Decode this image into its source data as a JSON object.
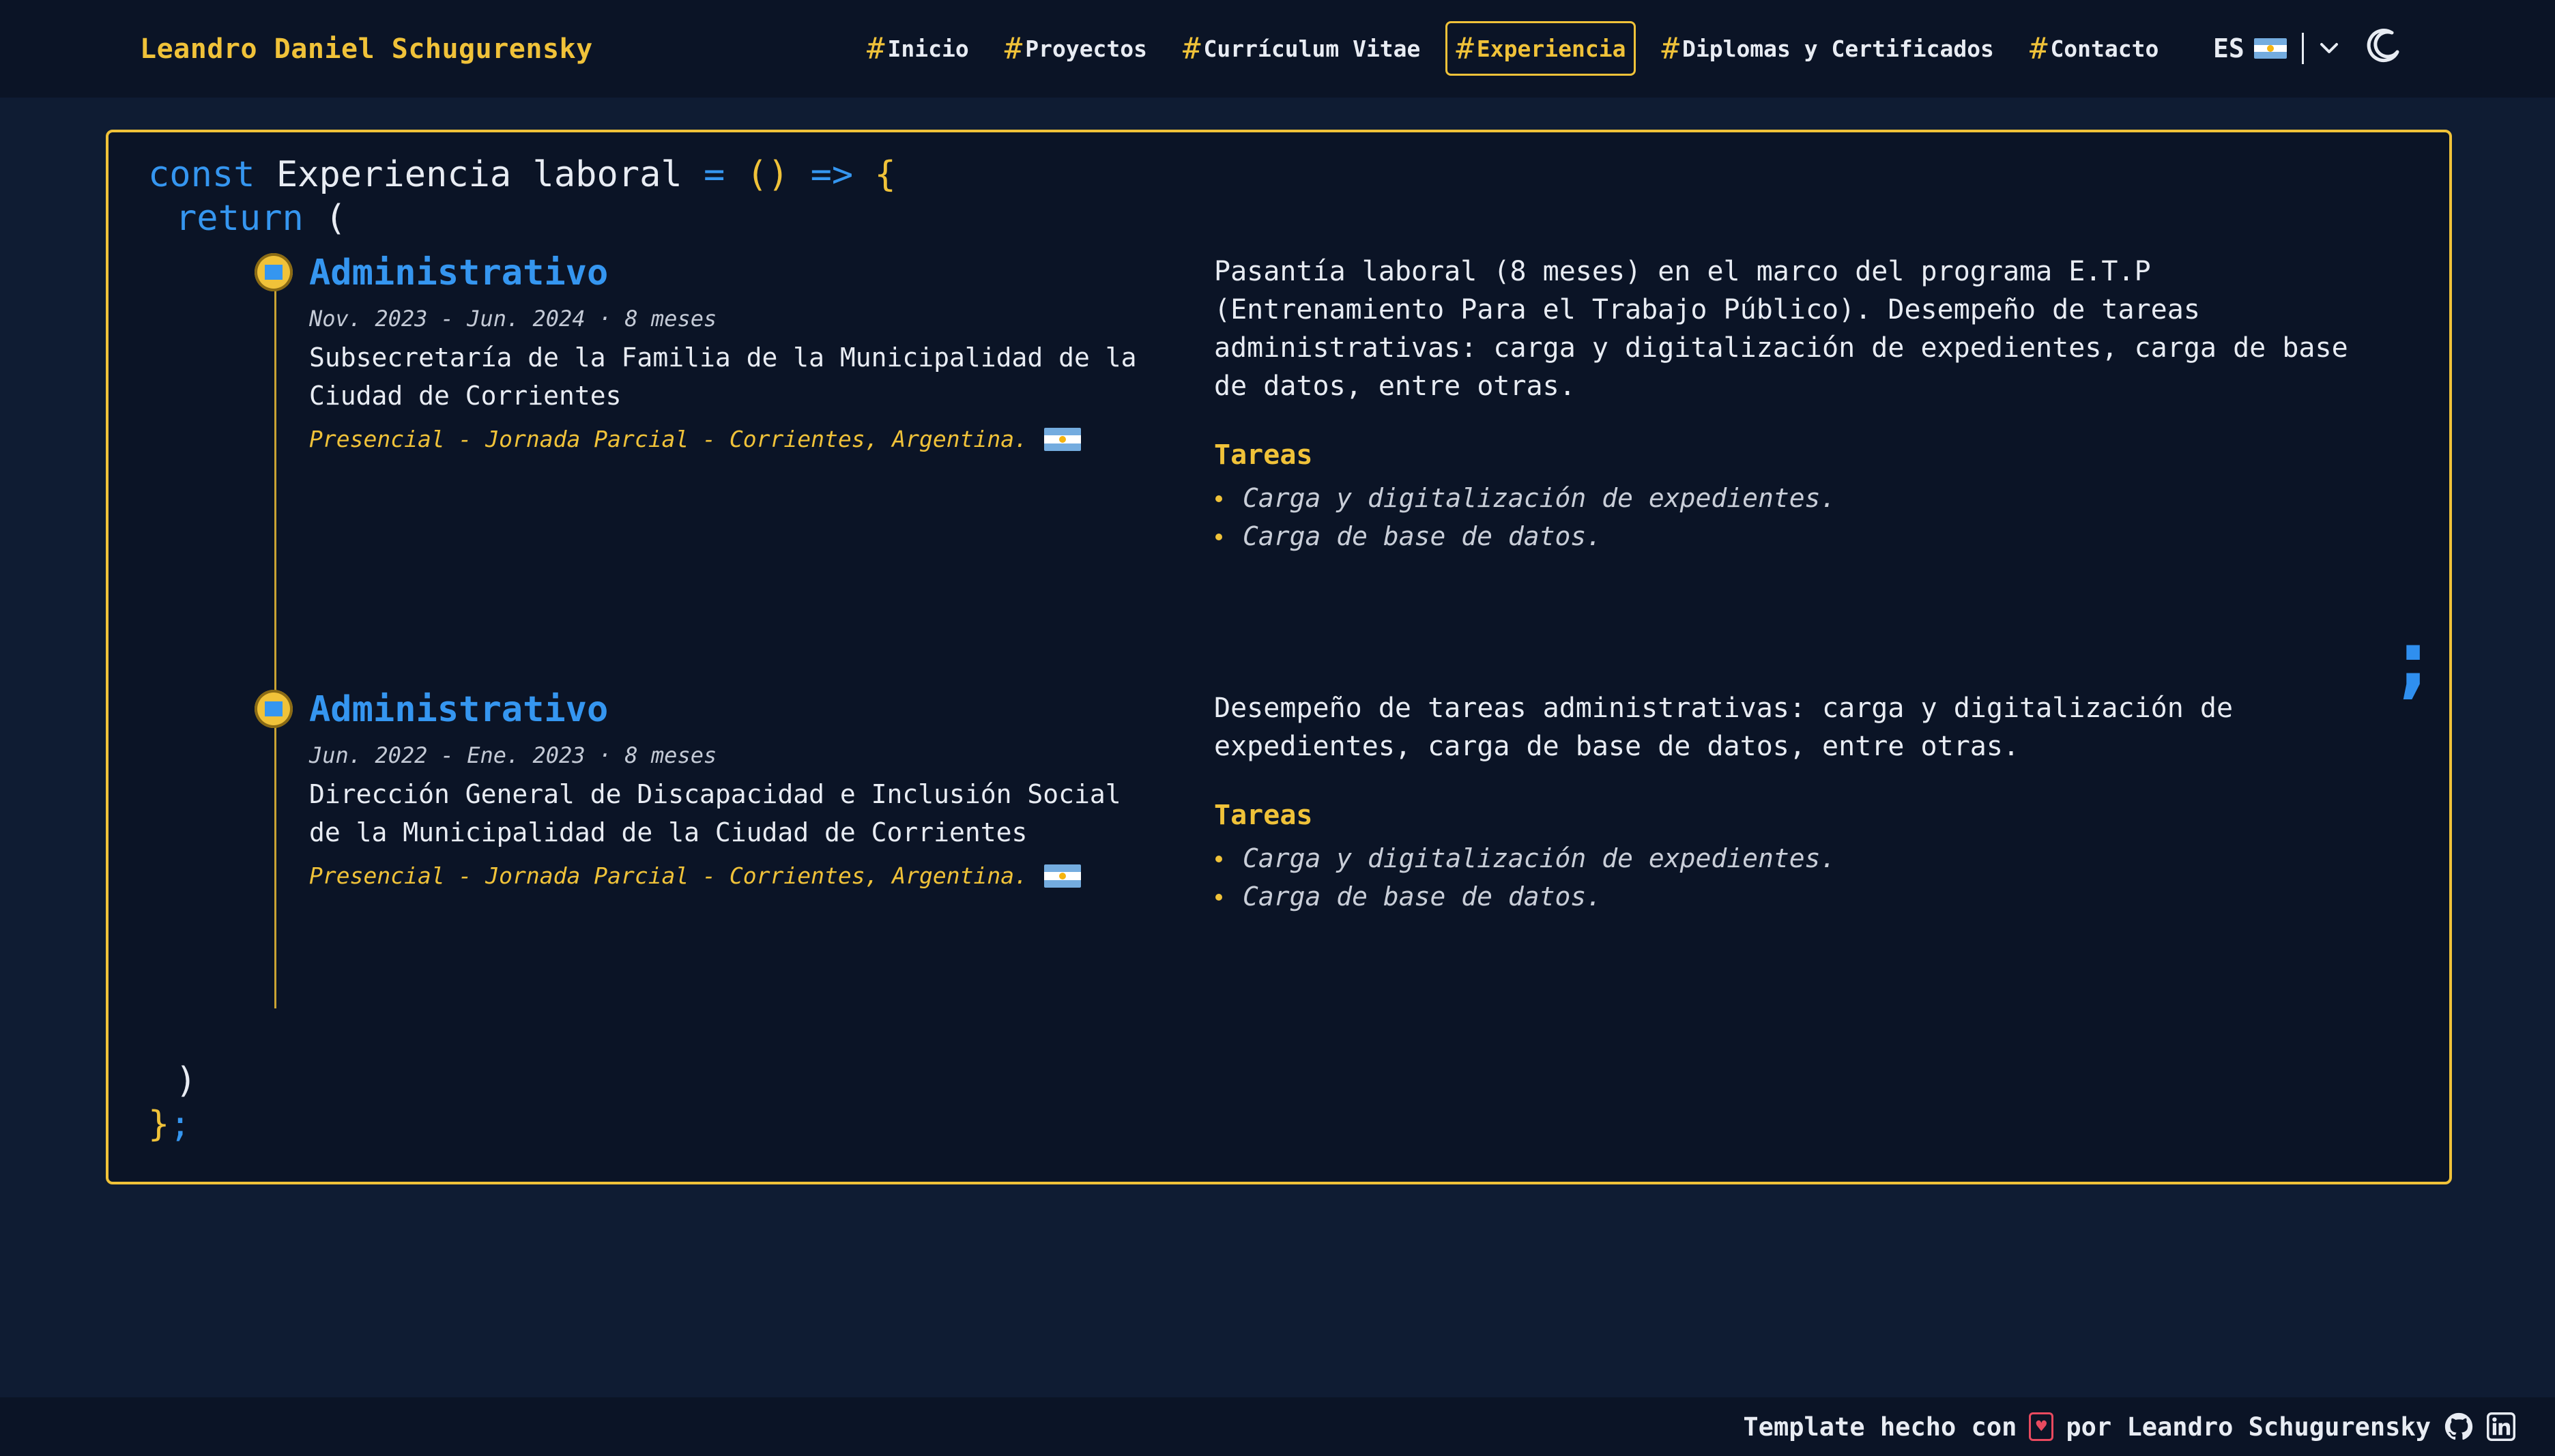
{
  "nav": {
    "brand": "Leandro Daniel Schugurensky",
    "hash": "#",
    "links": [
      {
        "label": "Inicio"
      },
      {
        "label": "Proyectos"
      },
      {
        "label": "Currículum Vitae"
      },
      {
        "label": "Experiencia",
        "active": true
      },
      {
        "label": "Diplomas y Certificados"
      },
      {
        "label": "Contacto"
      }
    ],
    "language": "ES",
    "flag_icon": "argentina-flag-icon",
    "theme_icon": "moon-icon"
  },
  "code": {
    "const_kw": "const",
    "component_name": "Experiencia laboral",
    "equals": "=",
    "parens": "()",
    "arrow": "=>",
    "open_brace": "{",
    "return_kw": "return",
    "open_paren": "(",
    "close_paren": ")",
    "close_brace": "}",
    "semicolon": ";"
  },
  "jobs": [
    {
      "title": "Administrativo",
      "dates": "Nov. 2023 - Jun. 2024 · 8 meses",
      "organization": "Subsecretaría de la Familia de la Municipalidad de la Ciudad de Corrientes",
      "location": "Presencial - Jornada Parcial - Corrientes, Argentina.",
      "description": "Pasantía laboral (8 meses) en el marco del programa E.T.P (Entrenamiento Para el Trabajo Público). Desempeño de tareas administrativas: carga y digitalización de expedientes, carga de base de datos, entre otras.",
      "tasks_heading": "Tareas",
      "tasks": [
        "Carga y digitalización de expedientes.",
        "Carga de base de datos."
      ]
    },
    {
      "title": "Administrativo",
      "dates": "Jun. 2022 - Ene. 2023 · 8 meses",
      "organization": "Dirección General de Discapacidad e Inclusión Social de la Municipalidad de la Ciudad de Corrientes",
      "location": "Presencial - Jornada Parcial - Corrientes, Argentina.",
      "description": "Desempeño de tareas administrativas: carga y digitalización de expedientes, carga de base de datos, entre otras.",
      "tasks_heading": "Tareas",
      "tasks": [
        "Carga y digitalización de expedientes.",
        "Carga de base de datos."
      ]
    }
  ],
  "side_semicolon": ";",
  "footer": {
    "text_before": "Template hecho con",
    "text_after": "por Leandro Schugurensky",
    "heart_icon": "heart-icon",
    "github_icon": "github-icon",
    "linkedin_icon": "linkedin-icon"
  },
  "colors": {
    "background": "#0f1c33",
    "panel": "#0b1426",
    "accent_yellow": "#f0c239",
    "accent_blue": "#3596f0"
  }
}
